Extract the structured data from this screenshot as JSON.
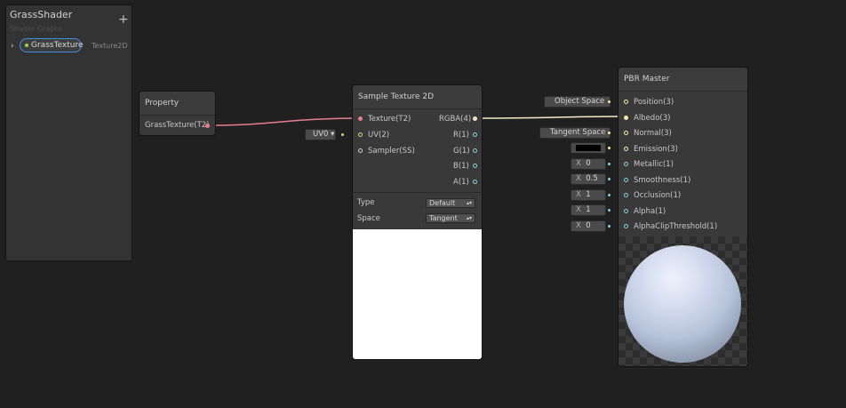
{
  "blackboard": {
    "title": "GrassShader",
    "subtitle": "Shader Graphs",
    "add_label": "+",
    "expand_glyph": "›",
    "property": {
      "name": "GrassTexture",
      "type": "Texture2D"
    }
  },
  "property_node": {
    "title": "Property",
    "output_label": "GrassTexture(T2)"
  },
  "uv_input": {
    "label": "UV0 ▾"
  },
  "sample_node": {
    "title": "Sample Texture 2D",
    "inputs": [
      "Texture(T2)",
      "UV(2)",
      "Sampler(SS)"
    ],
    "outputs": [
      "RGBA(4)",
      "R(1)",
      "G(1)",
      "B(1)",
      "A(1)"
    ],
    "type_label": "Type",
    "type_value": "Default",
    "space_label": "Space",
    "space_value": "Tangent"
  },
  "pbr_node": {
    "title": "PBR Master",
    "ports": [
      "Position(3)",
      "Albedo(3)",
      "Normal(3)",
      "Emission(3)",
      "Metallic(1)",
      "Smoothness(1)",
      "Occlusion(1)",
      "Alpha(1)",
      "AlphaClipThreshold(1)"
    ],
    "position_input": "Object Space",
    "normal_input": "Tangent Space",
    "emission_color": "#000000",
    "metallic_value": "0",
    "smoothness_value": "0.5",
    "occlusion_value": "1",
    "alpha_value": "1",
    "alpha_clip_value": "0",
    "x_label": "X"
  },
  "colors": {
    "background": "#202020",
    "texture_wire": "#e57e8e",
    "vector4_wire": "#f7f2a6",
    "selection": "#3f8fe2"
  }
}
